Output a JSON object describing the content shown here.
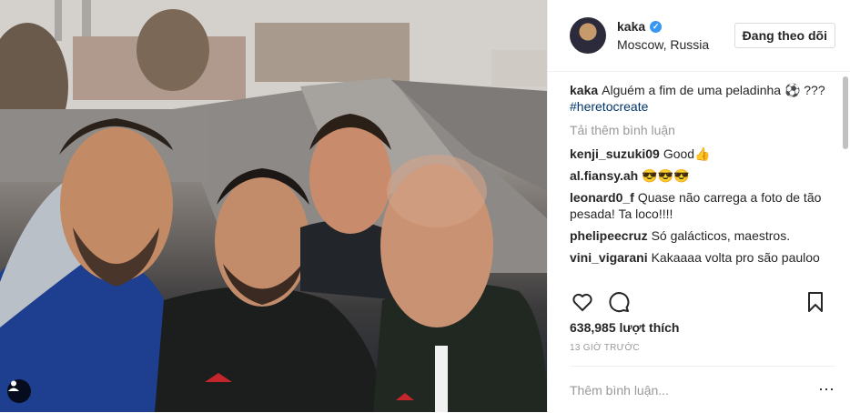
{
  "post": {
    "username": "kaka",
    "location": "Moscow, Russia",
    "follow_label": "Đang theo dõi",
    "caption_text": "Alguém a fim de uma peladinha ⚽ ???",
    "caption_hashtag": "#heretocreate",
    "load_more": "Tải thêm bình luận",
    "comments": [
      {
        "user": "kenji_suzuki09",
        "text": "Good👍"
      },
      {
        "user": "al.fiansy.ah",
        "text": "😎😎😎"
      },
      {
        "user": "leonard0_f",
        "text": "Quase não carrega a foto de tão pesada! Ta loco!!!!"
      },
      {
        "user": "phelipeecruz",
        "text": "Só galácticos, maestros."
      },
      {
        "user": "vini_vigarani",
        "text": "Kakaaaa volta pro são pauloo"
      }
    ],
    "likes": "638,985 lượt thích",
    "time": "13 GIỜ TRƯỚC",
    "add_comment_placeholder": "Thêm bình luận...",
    "more_icon": "⋯"
  },
  "icons": {
    "like": "heart-icon",
    "comment": "comment-icon",
    "save": "bookmark-icon",
    "tag": "user-tag-icon",
    "verified": "verified-badge-icon"
  },
  "colors": {
    "verified": "#3897f0",
    "hashtag": "#003569",
    "muted": "#999999"
  }
}
